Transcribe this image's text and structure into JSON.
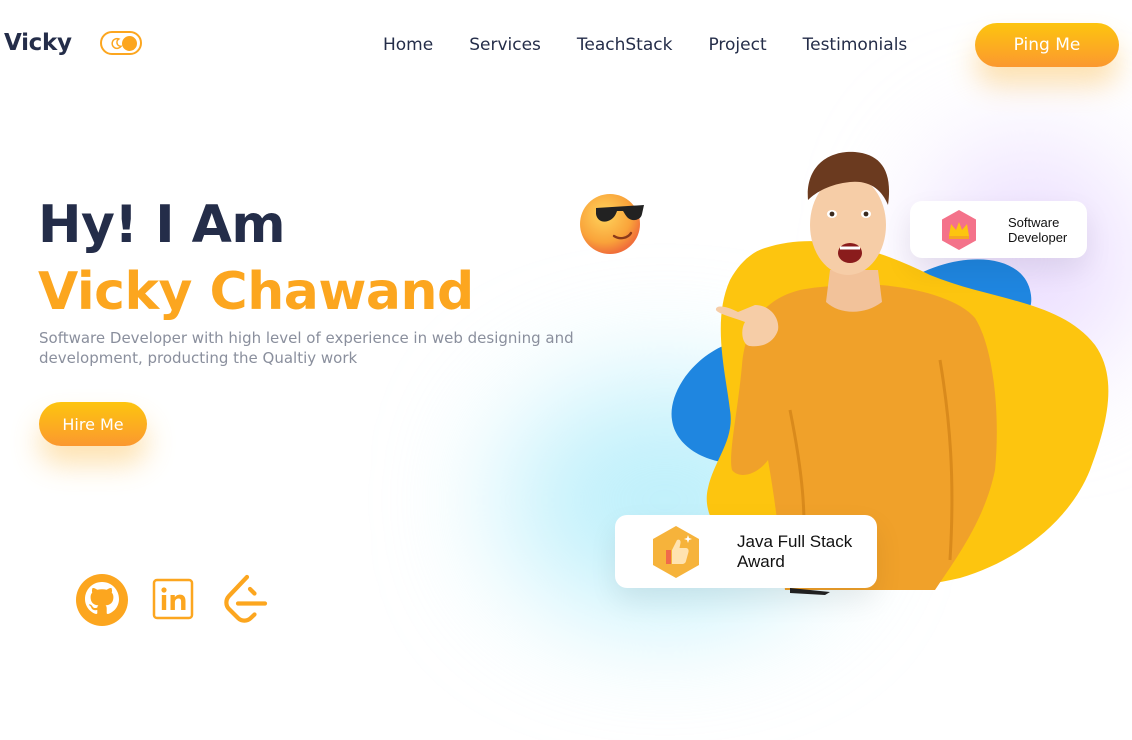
{
  "header": {
    "logo": "Vicky",
    "theme_toggle": {
      "state": "light",
      "icon": "moon-icon"
    },
    "nav": [
      "Home",
      "Services",
      "TeachStack",
      "Project",
      "Testimonials"
    ],
    "cta_label": "Ping Me"
  },
  "hero": {
    "greeting": "Hy! I Am",
    "name": "Vicky Chawand",
    "description": "Software Developer with high level of experience in web designing and development, producting the Qualtiy work",
    "cta_label": "Hire Me"
  },
  "social": [
    {
      "icon": "github-icon"
    },
    {
      "icon": "linkedin-icon"
    },
    {
      "icon": "leetcode-icon"
    }
  ],
  "floating_cards": {
    "software_developer": {
      "line1": "Software",
      "line2": "Developer",
      "icon": "crown-badge-icon"
    },
    "award": {
      "line1": "Java Full Stack",
      "line2": "Award",
      "icon": "thumbs-up-badge-icon"
    }
  },
  "colors": {
    "accent": "#fca61f",
    "accent_light": "#fdc50f",
    "text_dark": "#242d49",
    "text_muted": "#8a8f9d",
    "blob_yellow": "#fdc50f",
    "blob_blue": "#1f86e0"
  }
}
